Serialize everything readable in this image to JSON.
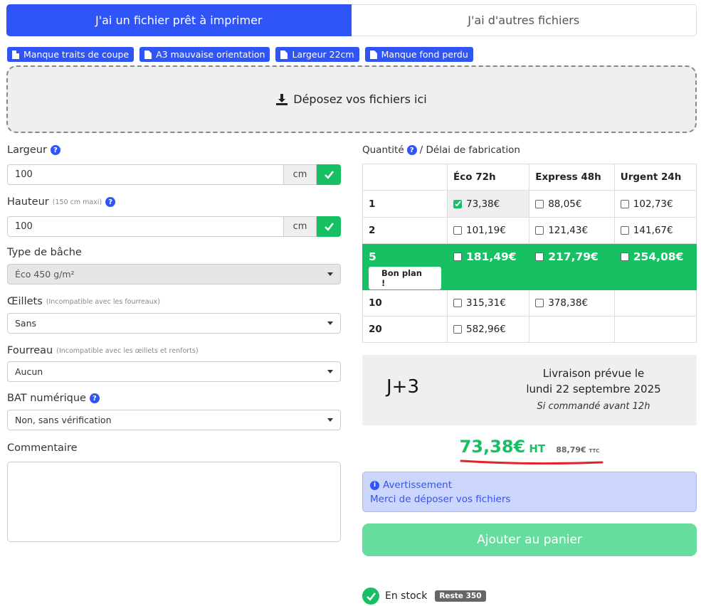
{
  "tabs": [
    {
      "label": "J'ai un fichier prêt à imprimer"
    },
    {
      "label": "J'ai d'autres fichiers"
    }
  ],
  "chips": [
    {
      "label": "Manque traits de coupe"
    },
    {
      "label": "A3 mauvaise orientation"
    },
    {
      "label": "Largeur 22cm"
    },
    {
      "label": "Manque fond perdu"
    }
  ],
  "dropzone": {
    "label": "Déposez vos fichiers ici"
  },
  "form": {
    "width": {
      "label": "Largeur",
      "value": "100",
      "unit": "cm"
    },
    "height": {
      "label": "Hauteur",
      "note": "(150 cm maxi)",
      "value": "100",
      "unit": "cm"
    },
    "tarp_type": {
      "label": "Type de bâche",
      "value": "Éco 450 g/m²"
    },
    "eyelets": {
      "label": "Œillets",
      "note": "(Incompatible avec les fourreaux)",
      "value": "Sans"
    },
    "sleeve": {
      "label": "Fourreau",
      "note": "(Incompatible avec les œillets et renforts)",
      "value": "Aucun"
    },
    "bat": {
      "label": "BAT numérique",
      "value": "Non, sans vérification"
    },
    "comment": {
      "label": "Commentaire"
    }
  },
  "pricing": {
    "label_qty": "Quantité",
    "label_delay": "/ Délai de fabrication",
    "columns": [
      "Éco 72h",
      "Express 48h",
      "Urgent 24h"
    ],
    "rows": [
      {
        "qty": "1",
        "prices": [
          "73,38€",
          "88,05€",
          "102,73€"
        ]
      },
      {
        "qty": "2",
        "prices": [
          "101,19€",
          "121,43€",
          "141,67€"
        ]
      },
      {
        "qty": "5",
        "prices": [
          "181,49€",
          "217,79€",
          "254,08€"
        ],
        "badge": "Bon plan !"
      },
      {
        "qty": "10",
        "prices": [
          "315,31€",
          "378,38€",
          ""
        ]
      },
      {
        "qty": "20",
        "prices": [
          "582,96€",
          "",
          ""
        ]
      }
    ]
  },
  "delivery": {
    "days": "J+3",
    "line1": "Livraison prévue le",
    "line2": "lundi 22 septembre 2025",
    "note": "Si commandé avant 12h"
  },
  "total": {
    "ht": "73,38€",
    "ht_label": "HT",
    "ttc": "88,79€",
    "ttc_label": "TTC"
  },
  "warning": {
    "title": "Avertissement",
    "message": "Merci de déposer vos fichiers"
  },
  "cart": {
    "label": "Ajouter au panier"
  },
  "stock": {
    "label": "En stock",
    "remaining": "Reste 350"
  },
  "colors": {
    "primary": "#2f55f7",
    "success": "#17c163",
    "cart": "#66dd9e",
    "warning_bg": "#ccd5fb",
    "underline": "#e0262c"
  }
}
